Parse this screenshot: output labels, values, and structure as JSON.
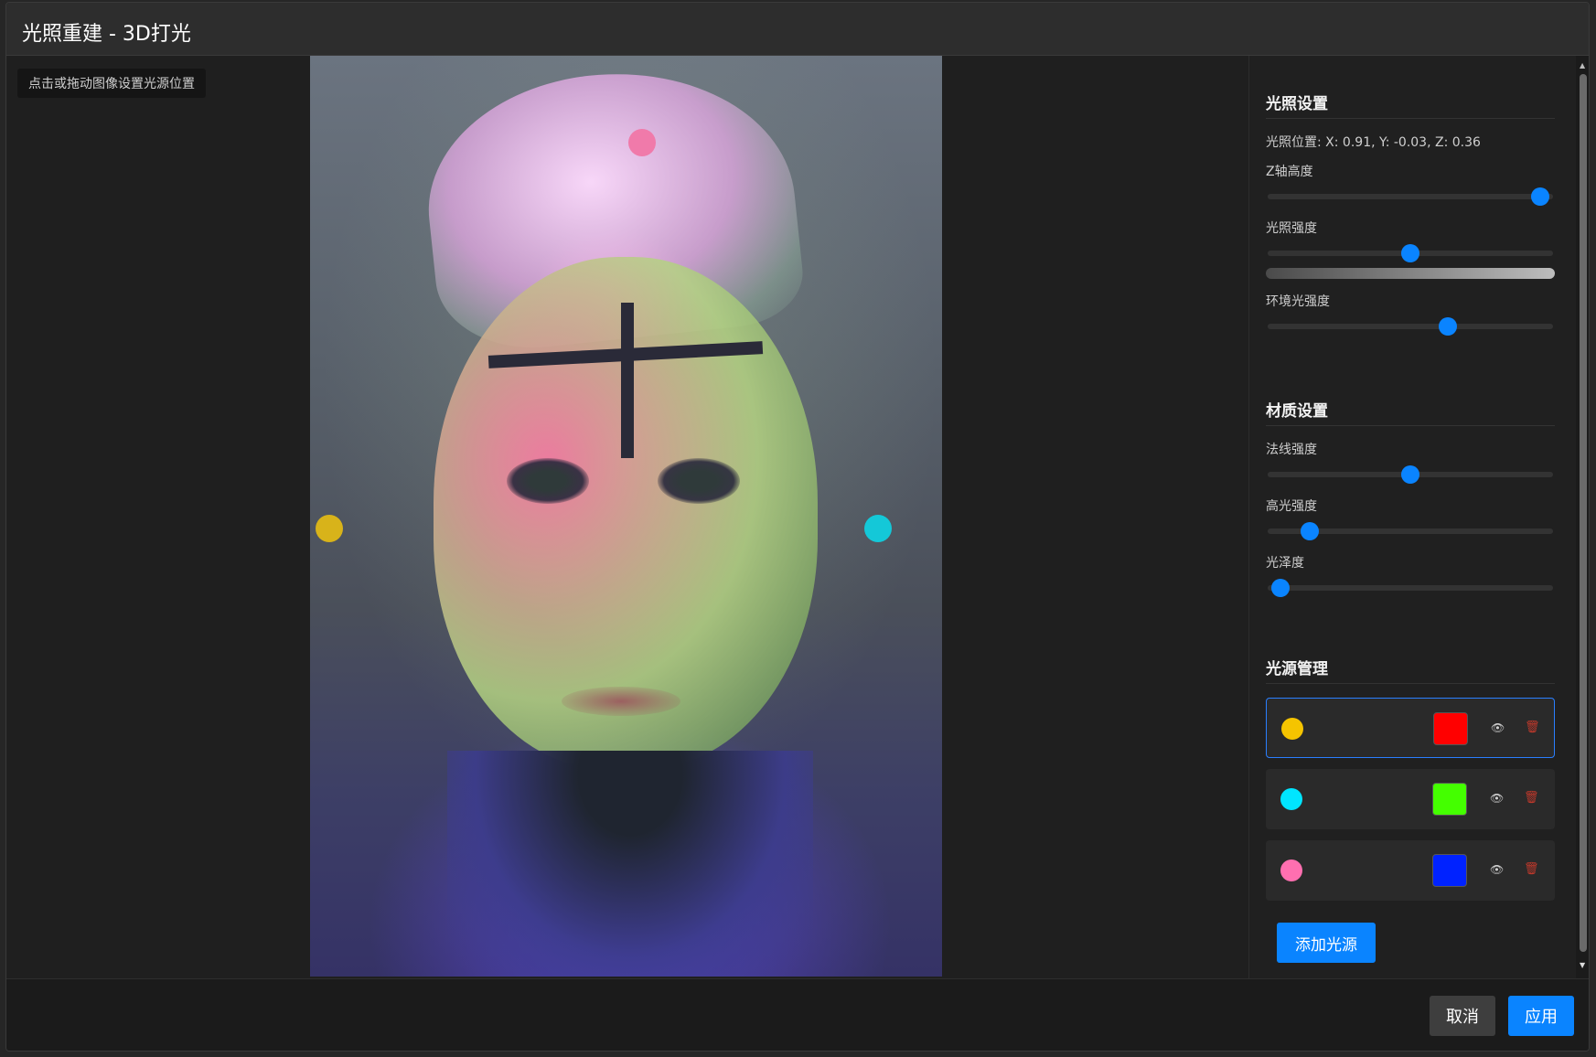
{
  "dialog": {
    "title": "光照重建 - 3D打光"
  },
  "canvas": {
    "hint": "点击或拖动图像设置光源位置"
  },
  "lighting": {
    "title": "光照设置",
    "position": "光照位置: X: 0.91, Y: -0.03, Z: 0.36",
    "z_height_label": "Z轴高度",
    "z_height_value": 0.98,
    "intensity_label": "光照强度",
    "intensity_value": 0.5,
    "ambient_label": "环境光强度",
    "ambient_value": 0.64
  },
  "material": {
    "title": "材质设置",
    "normal_label": "法线强度",
    "normal_value": 0.5,
    "specular_label": "高光强度",
    "specular_value": 0.13,
    "gloss_label": "光泽度",
    "gloss_value": 0.02
  },
  "light_sources": {
    "title": "光源管理",
    "items": [
      {
        "dot_color": "#f5c400",
        "swatch_color": "#ff0000",
        "active": true
      },
      {
        "dot_color": "#00e5ff",
        "swatch_color": "#44ff00",
        "active": false
      },
      {
        "dot_color": "#ff6fb0",
        "swatch_color": "#0022ff",
        "active": false
      }
    ],
    "add_label": "添加光源"
  },
  "footer": {
    "cancel_label": "取消",
    "apply_label": "应用"
  },
  "colors": {
    "accent": "#0a84ff",
    "background": "#1e1e1e"
  }
}
